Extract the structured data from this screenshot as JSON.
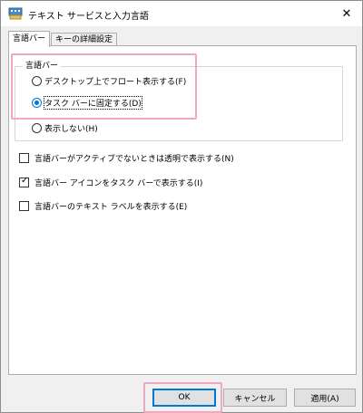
{
  "window": {
    "title": "テキスト サービスと入力言語",
    "close_glyph": "✕"
  },
  "tabs": [
    {
      "label": "言語バー",
      "active": true
    },
    {
      "label": "キーの詳細設定",
      "active": false
    }
  ],
  "language_bar_group": {
    "legend": "言語バー",
    "options": [
      {
        "label": "デスクトップ上でフロート表示する(F)",
        "selected": false
      },
      {
        "label": "タスク バーに固定する(D)",
        "selected": true
      },
      {
        "label": "表示しない(H)",
        "selected": false
      }
    ]
  },
  "checkboxes": [
    {
      "label": "言語バーがアクティブでないときは透明で表示する(N)",
      "checked": false
    },
    {
      "label": "言語バー アイコンをタスク バーで表示する(I)",
      "checked": true
    },
    {
      "label": "言語バーのテキスト ラベルを表示する(E)",
      "checked": false
    }
  ],
  "buttons": {
    "ok": "OK",
    "cancel": "キャンセル",
    "apply": "適用(A)"
  },
  "colors": {
    "accent": "#0078d7",
    "highlight": "#f2a6c6"
  }
}
